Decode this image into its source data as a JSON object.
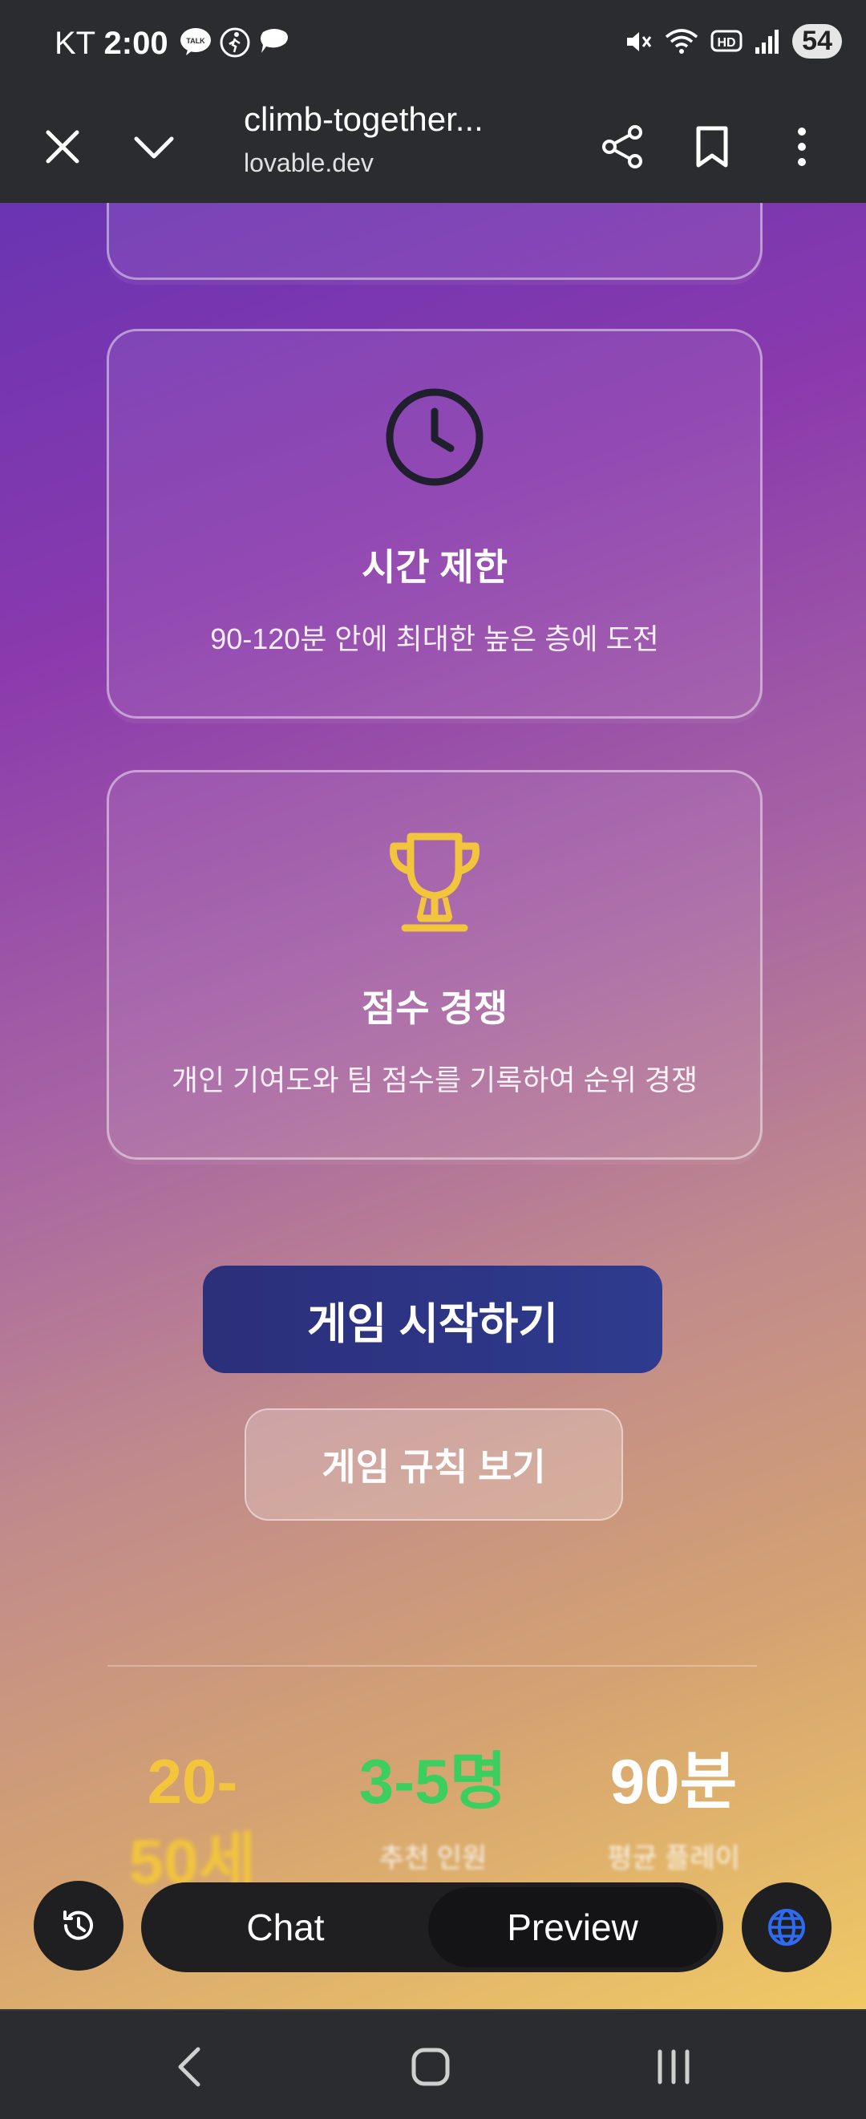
{
  "status_bar": {
    "carrier": "KT",
    "time": "2:00",
    "battery": "54",
    "talk_badge": "TALK",
    "hd_badge": "HD"
  },
  "browser": {
    "title": "climb-together...",
    "domain": "lovable.dev"
  },
  "cards": [
    {
      "icon": "clock-icon",
      "icon_color": "#1f1f2e",
      "title": "시간 제한",
      "description": "90-120분 안에 최대한 높은 층에 도전"
    },
    {
      "icon": "trophy-icon",
      "icon_color": "#f2c53d",
      "title": "점수 경쟁",
      "description": "개인 기여도와 팀 점수를 기록하여 순위 경쟁"
    }
  ],
  "buttons": {
    "start_game": "게임 시작하기",
    "view_rules": "게임 규칙 보기"
  },
  "stats": [
    {
      "value_line1": "20-",
      "value_line2": "50세",
      "label": "",
      "color": "#f2c53d"
    },
    {
      "value_line1": "3-5명",
      "label": "추천 인원",
      "color": "#3ccf5f"
    },
    {
      "value_line1": "90분",
      "label": "평균 플레이",
      "color": "#ffffff"
    }
  ],
  "bottom_bar": {
    "chat_label": "Chat",
    "preview_label": "Preview"
  },
  "colors": {
    "accent_blue": "#2c2f7a",
    "globe_blue": "#2f6bf0"
  }
}
